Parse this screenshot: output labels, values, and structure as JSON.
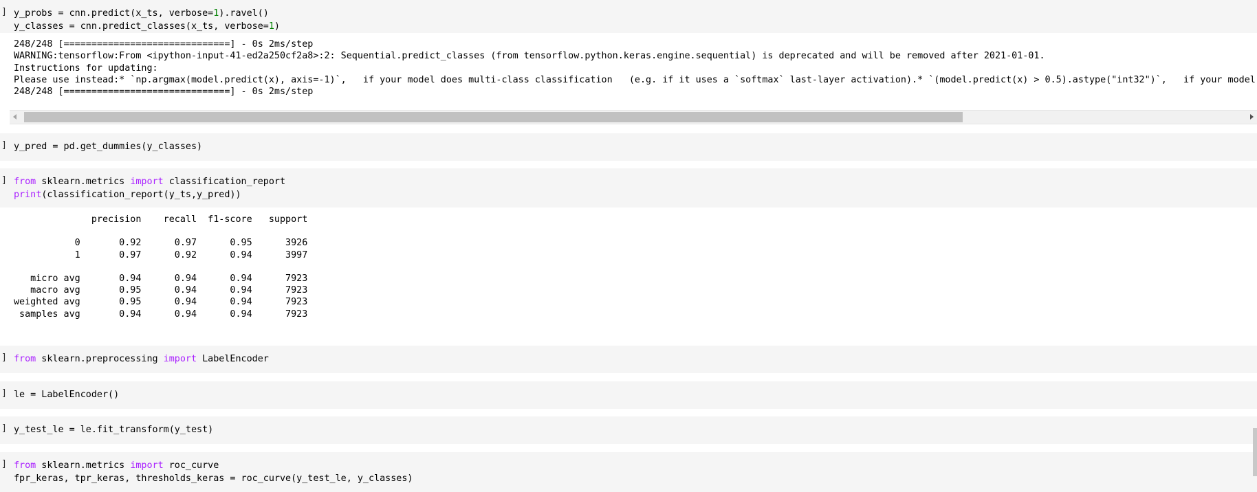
{
  "cells": [
    {
      "prompt": "]",
      "code_lines": [
        [
          {
            "t": "y_probs = cnn.predict(x_ts, verbose="
          },
          {
            "t": "1",
            "c": "num"
          },
          {
            "t": ").ravel()"
          }
        ],
        [
          {
            "t": "y_classes = cnn.predict_classes(x_ts, verbose="
          },
          {
            "t": "1",
            "c": "num"
          },
          {
            "t": ")"
          }
        ]
      ]
    }
  ],
  "output1": [
    "248/248 [==============================] - 0s 2ms/step",
    "WARNING:tensorflow:From <ipython-input-41-ed2a250cf2a8>:2: Sequential.predict_classes (from tensorflow.python.keras.engine.sequential) is deprecated and will be removed after 2021-01-01.",
    "Instructions for updating:",
    "Please use instead:* `np.argmax(model.predict(x), axis=-1)`,   if your model does multi-class classification   (e.g. if it uses a `softmax` last-layer activation).* `(model.predict(x) > 0.5).astype(\"int32\")`,   if your model does bina",
    "248/248 [==============================] - 0s 2ms/step"
  ],
  "cell2": {
    "prompt": "]",
    "line": "y_pred = pd.get_dummies(y_classes)"
  },
  "cell3": {
    "prompt": "]",
    "lines": [
      [
        {
          "t": "from",
          "c": "kw"
        },
        {
          "t": " sklearn.metrics "
        },
        {
          "t": "import",
          "c": "kw"
        },
        {
          "t": " classification_report"
        }
      ],
      [
        {
          "t": "print",
          "c": "kw"
        },
        {
          "t": "(classification_report(y_ts,y_pred))"
        }
      ]
    ]
  },
  "report": [
    "              precision    recall  f1-score   support",
    "",
    "           0       0.92      0.97      0.95      3926",
    "           1       0.97      0.92      0.94      3997",
    "",
    "   micro avg       0.94      0.94      0.94      7923",
    "   macro avg       0.95      0.94      0.94      7923",
    "weighted avg       0.95      0.94      0.94      7923",
    " samples avg       0.94      0.94      0.94      7923"
  ],
  "cell4": {
    "prompt": "]",
    "lines": [
      [
        {
          "t": "from",
          "c": "kw"
        },
        {
          "t": " sklearn.preprocessing "
        },
        {
          "t": "import",
          "c": "kw"
        },
        {
          "t": " LabelEncoder"
        }
      ]
    ]
  },
  "cell5": {
    "prompt": "]",
    "line": "le = LabelEncoder()"
  },
  "cell6": {
    "prompt": "]",
    "line": "y_test_le = le.fit_transform(y_test)"
  },
  "cell7": {
    "prompt": "]",
    "lines": [
      [
        {
          "t": "from",
          "c": "kw"
        },
        {
          "t": " sklearn.metrics "
        },
        {
          "t": "import",
          "c": "kw"
        },
        {
          "t": " roc_curve"
        }
      ],
      [
        {
          "t": "fpr_keras, tpr_keras, thresholds_keras = roc_curve(y_test_le, y_classes)"
        }
      ]
    ]
  },
  "icons": {
    "scroll_left": "chevron-left-icon",
    "scroll_right": "chevron-right-icon"
  }
}
